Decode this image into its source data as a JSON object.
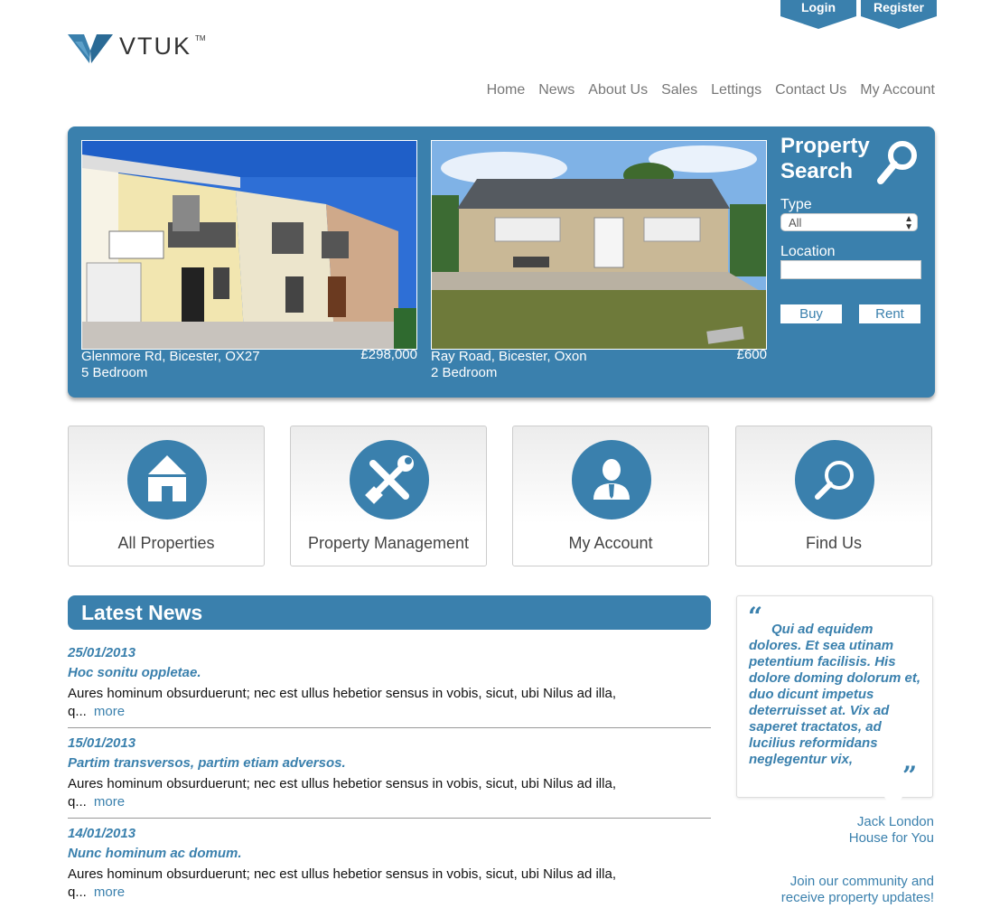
{
  "account": {
    "login": "Login",
    "register": "Register"
  },
  "brand": {
    "name": "VTUK",
    "tm": "TM"
  },
  "nav": [
    "Home",
    "News",
    "About Us",
    "Sales",
    "Lettings",
    "Contact Us",
    "My Account"
  ],
  "featured": [
    {
      "address": "Glenmore Rd, Bicester, OX27",
      "bedrooms": "5 Bedroom",
      "price": "£298,000"
    },
    {
      "address": "Ray Road, Bicester, Oxon",
      "bedrooms": "2 Bedroom",
      "price": "£600"
    }
  ],
  "search": {
    "title_line1": "Property",
    "title_line2": "Search",
    "type_label": "Type",
    "type_value": "All",
    "location_label": "Location",
    "location_value": "",
    "buy": "Buy",
    "rent": "Rent"
  },
  "tiles": [
    "All Properties",
    "Property Management",
    "My Account",
    "Find Us"
  ],
  "news": {
    "heading": "Latest News",
    "items": [
      {
        "date": "25/01/2013",
        "title": "Hoc sonitu oppletae.",
        "body": "Aures hominum obsurduerunt; nec est ullus hebetior sensus in vobis, sicut, ubi Nilus ad illa, q...",
        "more": "more"
      },
      {
        "date": "15/01/2013",
        "title": "Partim transversos, partim etiam adversos.",
        "body": "Aures hominum obsurduerunt; nec est ullus hebetior sensus in vobis, sicut, ubi Nilus ad illa, q...",
        "more": "more"
      },
      {
        "date": "14/01/2013",
        "title": "Nunc hominum ac domum.",
        "body": "Aures hominum obsurduerunt; nec est ullus hebetior sensus in vobis, sicut, ubi Nilus ad illa, q...",
        "more": "more"
      }
    ]
  },
  "testimonial": {
    "text": "Qui ad equidem dolores. Et sea utinam petentium facilisis. His dolore doming dolorum et, duo dicunt impetus deterruisset at. Vix ad saperet tractatos, ad lucilius reformidans neglegentur vix,",
    "author": "Jack London",
    "company": "House for You"
  },
  "community": {
    "line1": "Join our community and",
    "line2": "receive property updates!"
  }
}
